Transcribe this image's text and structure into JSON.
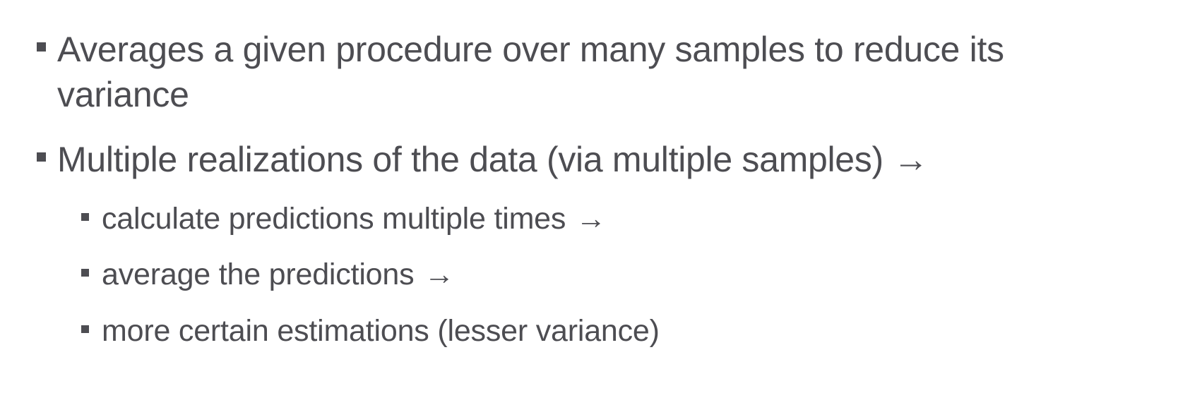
{
  "bullets": [
    {
      "text": "Averages a given procedure over many samples to reduce its variance",
      "arrow": ""
    },
    {
      "text": "Multiple realizations of the data (via multiple samples)",
      "arrow": "→",
      "sub": [
        {
          "text": "calculate predictions multiple times",
          "arrow": "→"
        },
        {
          "text": "average the predictions",
          "arrow": "→"
        },
        {
          "text": "more certain estimations (lesser variance)",
          "arrow": ""
        }
      ]
    }
  ]
}
